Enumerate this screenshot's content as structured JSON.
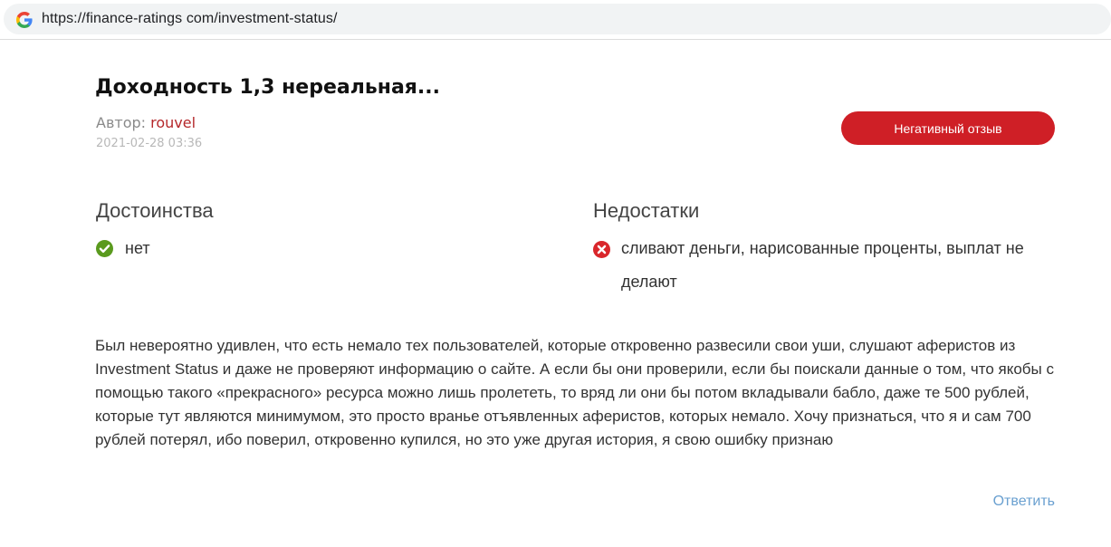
{
  "browser": {
    "url": "https://finance-ratings com/investment-status/"
  },
  "review": {
    "title": "Доходность 1,3 нереальная...",
    "author_label": "Автор: ",
    "author_name": "rouvel",
    "date": "2021-02-28 03:36",
    "badge": "Негативный отзыв",
    "pros_heading": "Достоинства",
    "pros_text": "нет",
    "cons_heading": "Недостатки",
    "cons_text": "сливают деньги, нарисованные проценты, выплат не делают",
    "body": "Был невероятно удивлен, что есть немало тех пользователей, которые откровенно развесили свои уши, слушают аферистов из Investment Status и даже не проверяют информацию о сайте. А если бы они проверили, если бы поискали данные о том, что якобы с помощью такого «прекрасного» ресурса можно лишь пролететь, то вряд ли они бы потом вкладывали бабло, даже те 500 рублей, которые тут являются минимумом, это просто вранье отъявленных аферистов, которых немало. Хочу признаться, что я и сам 700 рублей потерял, ибо поверил, откровенно купился, но это уже другая история, я свою ошибку признаю",
    "reply_label": "Ответить"
  },
  "icons": {
    "browser": "google-g-icon",
    "pros": "check-circle-icon",
    "cons": "x-circle-icon"
  },
  "colors": {
    "badge_bg": "#cf1f26",
    "author_name": "#b5282b",
    "pros_icon": "#5a9a1e",
    "cons_icon": "#d9262b",
    "reply_link": "#6aa0d0"
  }
}
